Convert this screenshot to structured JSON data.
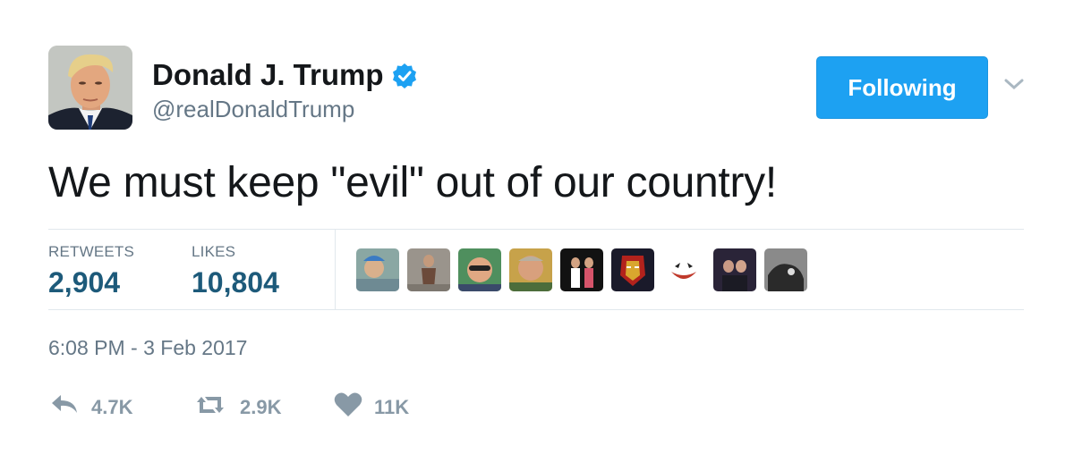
{
  "author": {
    "name": "Donald J. Trump",
    "handle": "@realDonaldTrump",
    "verified": true
  },
  "follow_button": {
    "label": "Following"
  },
  "tweet": {
    "text": "We must keep \"evil\" out of our country!",
    "timestamp": "6:08 PM - 3 Feb 2017"
  },
  "stats": {
    "retweets_label": "RETWEETS",
    "retweets_value": "2,904",
    "likes_label": "LIKES",
    "likes_value": "10,804"
  },
  "likers": [
    {
      "icon": "user-avatar"
    },
    {
      "icon": "user-avatar"
    },
    {
      "icon": "user-avatar"
    },
    {
      "icon": "user-avatar"
    },
    {
      "icon": "user-avatar"
    },
    {
      "icon": "iron-man-avatar"
    },
    {
      "icon": "joker-smile-avatar"
    },
    {
      "icon": "user-avatar"
    },
    {
      "icon": "user-avatar"
    }
  ],
  "actions": {
    "reply_count": "4.7K",
    "retweet_count": "2.9K",
    "like_count": "11K"
  },
  "colors": {
    "accent": "#1da1f2",
    "stat_value": "#1d5a7a",
    "secondary_text": "#657786",
    "action_gray": "#8899a6"
  }
}
